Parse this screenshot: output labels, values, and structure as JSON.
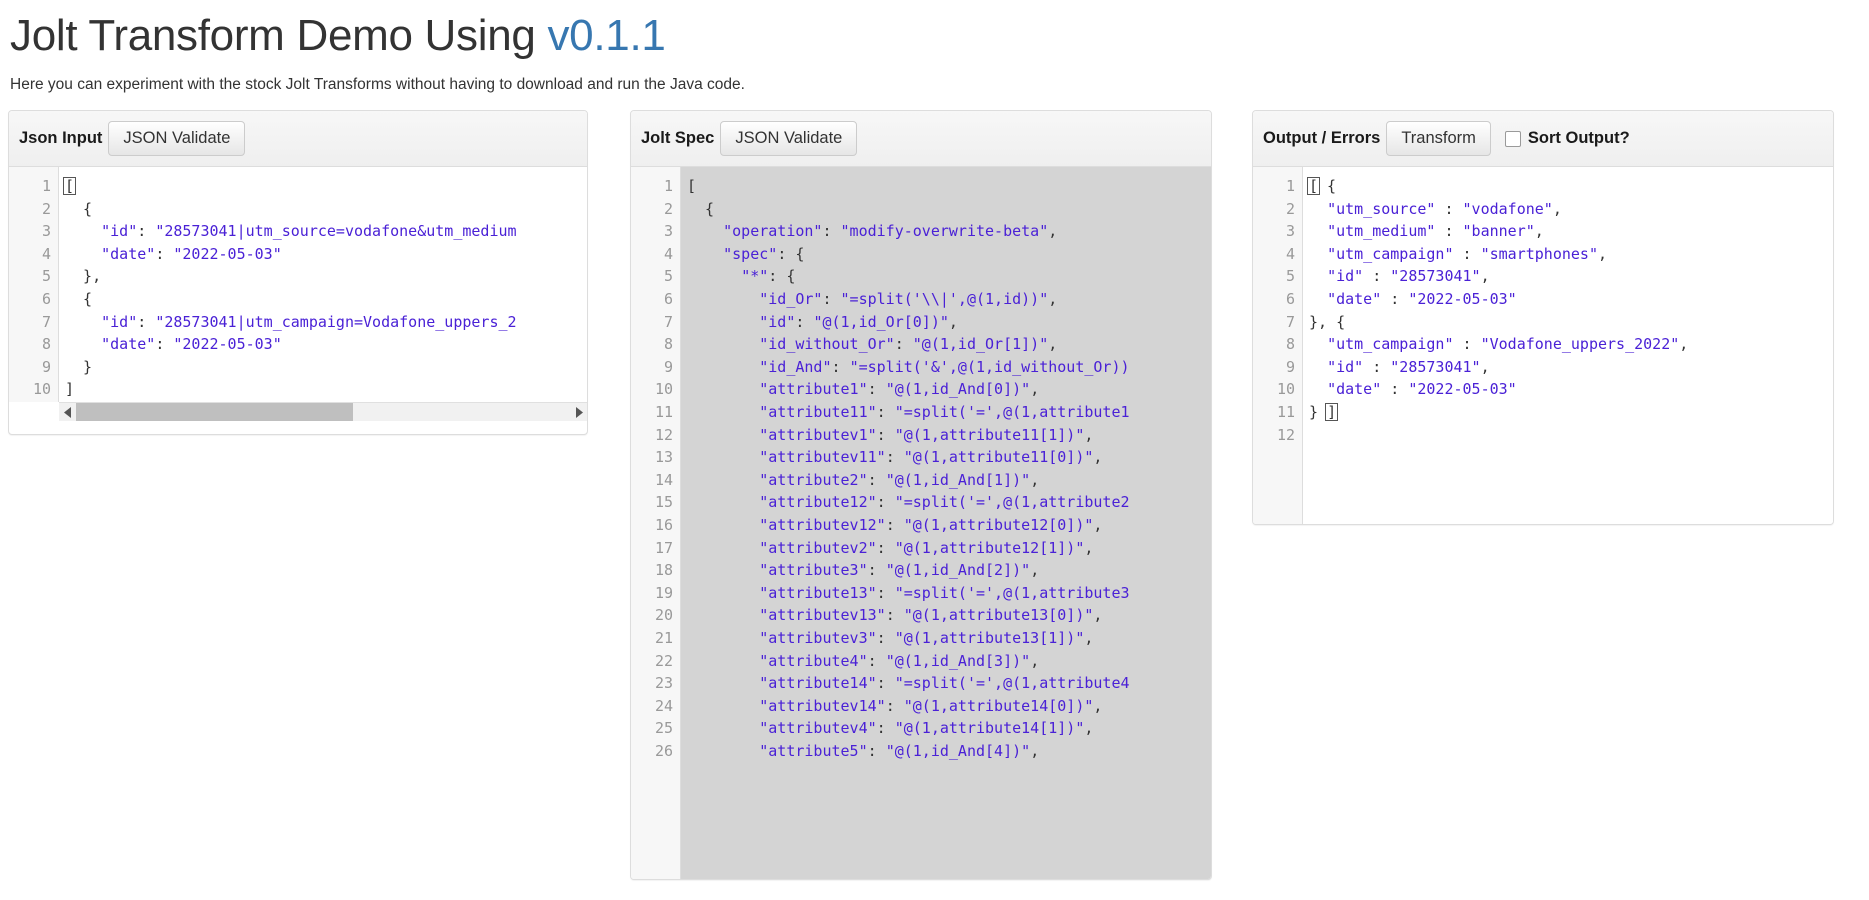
{
  "header": {
    "title_main": "Jolt Transform Demo Using ",
    "title_version": "v0.1.1",
    "subtitle": "Here you can experiment with the stock Jolt Transforms without having to download and run the Java code."
  },
  "input_panel": {
    "title": "Json Input",
    "validate_label": "JSON Validate",
    "line_numbers": [
      "1",
      "2",
      "3",
      "4",
      "5",
      "6",
      "7",
      "8",
      "9",
      "10"
    ],
    "lines": [
      "[",
      "  {",
      "    \"id\": \"28573041|utm_source=vodafone&utm_medium",
      "    \"date\": \"2022-05-03\"",
      "  },",
      "  {",
      "    \"id\": \"28573041|utm_campaign=Vodafone_uppers_2",
      "    \"date\": \"2022-05-03\"",
      "  }",
      "]"
    ],
    "cursor_line": 1,
    "cursor_char": "[",
    "scrollbar": {
      "left_arrow": "scroll-left-arrow",
      "right_arrow": "scroll-right-arrow",
      "thumb_position_pct": 0,
      "thumb_width_pct": 56
    }
  },
  "spec_panel": {
    "title": "Jolt Spec",
    "validate_label": "JSON Validate",
    "line_numbers": [
      "1",
      "2",
      "3",
      "4",
      "5",
      "6",
      "7",
      "8",
      "9",
      "10",
      "11",
      "12",
      "13",
      "14",
      "15",
      "16",
      "17",
      "18",
      "19",
      "20",
      "21",
      "22",
      "23",
      "24",
      "25",
      "26"
    ],
    "lines": [
      "[",
      "  {",
      "    \"operation\": \"modify-overwrite-beta\",",
      "    \"spec\": {",
      "      \"*\": {",
      "        \"id_Or\": \"=split('\\\\|',@(1,id))\",",
      "        \"id\": \"@(1,id_Or[0])\",",
      "        \"id_without_Or\": \"@(1,id_Or[1])\",",
      "        \"id_And\": \"=split('&',@(1,id_without_Or))",
      "        \"attribute1\": \"@(1,id_And[0])\",",
      "        \"attribute11\": \"=split('=',@(1,attribute1",
      "        \"attributev1\": \"@(1,attribute11[1])\",",
      "        \"attributev11\": \"@(1,attribute11[0])\",",
      "        \"attribute2\": \"@(1,id_And[1])\",",
      "        \"attribute12\": \"=split('=',@(1,attribute2",
      "        \"attributev12\": \"@(1,attribute12[0])\",",
      "        \"attributev2\": \"@(1,attribute12[1])\",",
      "        \"attribute3\": \"@(1,id_And[2])\",",
      "        \"attribute13\": \"=split('=',@(1,attribute3",
      "        \"attributev13\": \"@(1,attribute13[0])\",",
      "        \"attributev3\": \"@(1,attribute13[1])\",",
      "        \"attribute4\": \"@(1,id_And[3])\",",
      "        \"attribute14\": \"=split('=',@(1,attribute4",
      "        \"attributev14\": \"@(1,attribute14[0])\",",
      "        \"attributev4\": \"@(1,attribute14[1])\",",
      "        \"attribute5\": \"@(1,id_And[4])\","
    ],
    "selected": true
  },
  "output_panel": {
    "title": "Output / Errors",
    "transform_label": "Transform",
    "sort_label": "Sort Output?",
    "sort_checked": false,
    "line_numbers": [
      "1",
      "2",
      "3",
      "4",
      "5",
      "6",
      "7",
      "8",
      "9",
      "10",
      "11",
      "12"
    ],
    "lines": [
      "[ {",
      "  \"utm_source\" : \"vodafone\",",
      "  \"utm_medium\" : \"banner\",",
      "  \"utm_campaign\" : \"smartphones\",",
      "  \"id\" : \"28573041\",",
      "  \"date\" : \"2022-05-03\"",
      "}, {",
      "  \"utm_campaign\" : \"Vodafone_uppers_2022\",",
      "  \"id\" : \"28573041\",",
      "  \"date\" : \"2022-05-03\"",
      "} ]",
      ""
    ],
    "cursor_line_first": 1,
    "cursor_char_first": "[",
    "cursor_line_last": 11,
    "cursor_char_last": "]"
  },
  "colors": {
    "accent_link": "#3777b0",
    "code_string": "#4a21d6",
    "code_punct": "#333333",
    "panel_border": "#dddddd",
    "panel_head_bg": "#efefef",
    "selection_bg": "#d4d4d4",
    "gutter_text": "#999999"
  }
}
